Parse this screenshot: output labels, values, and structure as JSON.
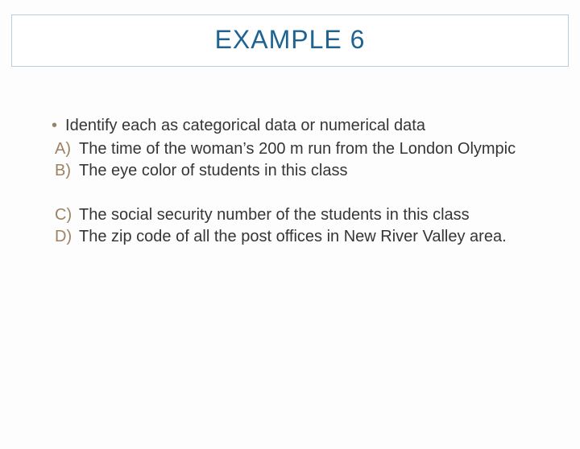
{
  "title": "EXAMPLE 6",
  "bullet": "Identify each as categorical data or numerical data",
  "items": {
    "a": {
      "label": "A)",
      "text": "The time of the woman’s  200 m run from the London Olympic"
    },
    "b": {
      "label": "B)",
      "text": "The eye color of students in this class"
    },
    "c": {
      "label": "C)",
      "text": "The social security number of the students in this class"
    },
    "d": {
      "label": "D)",
      "text": "The zip code of all the post offices in New River Valley area."
    }
  }
}
